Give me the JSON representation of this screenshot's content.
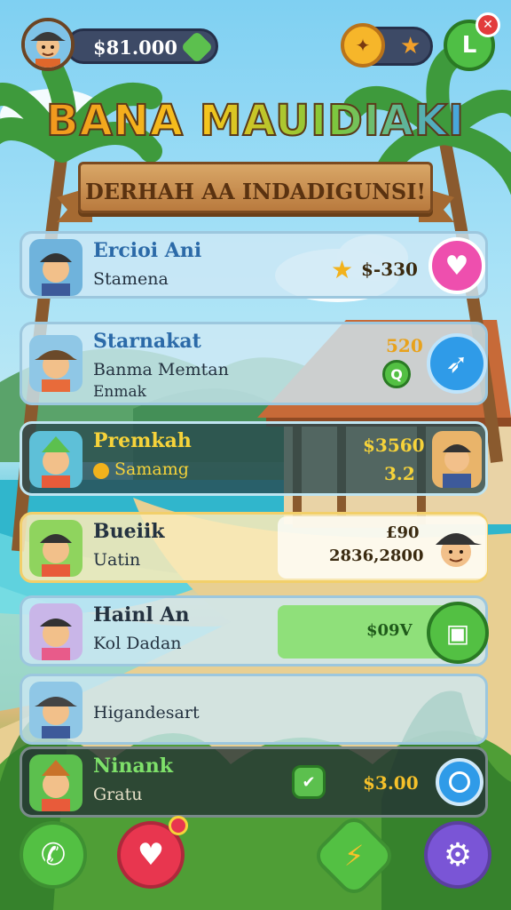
{
  "header": {
    "coins": "$81.000",
    "title": "BANA MAUIDIAKI",
    "subtitle": "DERHAH AA INDADIGUNSI!"
  },
  "list": [
    {
      "name": "Ercioi Ani",
      "sub": "Stamena",
      "sub2": "",
      "price": "$-330",
      "price2": ""
    },
    {
      "name": "Starnakat",
      "sub": "Banma Memtan",
      "sub2": "Enmak",
      "price": "520",
      "price2": ""
    },
    {
      "name": "Premkah",
      "sub": "Samamg",
      "sub2": "",
      "price": "$3560",
      "price2": "3.2"
    },
    {
      "name": "Bueiik",
      "sub": "Uatin",
      "sub2": "",
      "price": "£90",
      "price2": "2836,2800"
    },
    {
      "name": "Hainl An",
      "sub": "Kol Dadan",
      "sub2": "",
      "price": "$09V",
      "price2": ""
    },
    {
      "name": "",
      "sub": "Higandesart",
      "sub2": "",
      "price": "",
      "price2": ""
    },
    {
      "name": "Ninank",
      "sub": "Gratu",
      "sub2": "",
      "price": "$3.00",
      "price2": ""
    }
  ],
  "icons": {
    "top": [
      "avatar",
      "gem-icon",
      "coin-icon",
      "star-icon",
      "level-icon",
      "close-icon"
    ],
    "row_actions": [
      "heart-icon",
      "rocket-icon",
      "map-icon",
      "globe-icon"
    ],
    "nav": [
      "phone-icon",
      "heart-icon",
      "lightning-icon",
      "gear-icon"
    ]
  },
  "colors": {
    "row_light": "#cfe6f3",
    "row_highlight": "#f6e7b5",
    "row_dark": "#2c4a4a",
    "accent_pink": "#ee4fae",
    "accent_blue": "#2f9be8",
    "accent_green": "#53c043",
    "accent_purple": "#7a55d6",
    "accent_red": "#e8364f"
  }
}
